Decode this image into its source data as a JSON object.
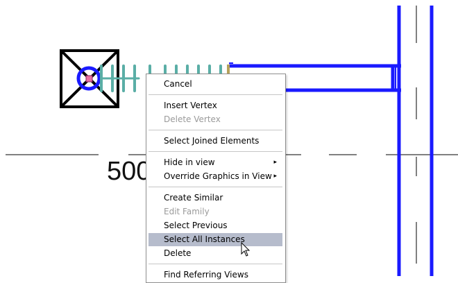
{
  "drawing": {
    "dimension_text": "500"
  },
  "context_menu": {
    "items": [
      {
        "label": "Cancel",
        "enabled": true
      },
      {
        "label": "Insert Vertex",
        "enabled": true
      },
      {
        "label": "Delete Vertex",
        "enabled": false
      },
      {
        "label": "Select Joined Elements",
        "enabled": true
      },
      {
        "label": "Hide in view",
        "enabled": true,
        "submenu": true
      },
      {
        "label": "Override Graphics in View",
        "enabled": true,
        "submenu": true
      },
      {
        "label": "Create Similar",
        "enabled": true
      },
      {
        "label": "Edit Family",
        "enabled": false
      },
      {
        "label": "Select Previous",
        "enabled": true
      },
      {
        "label": "Select All Instances",
        "enabled": true,
        "highlighted": true
      },
      {
        "label": "Delete",
        "enabled": true
      },
      {
        "label": "Find Referring Views",
        "enabled": true
      }
    ],
    "submenu_arrow": "▸"
  },
  "colors": {
    "structure_blue": "#1a1aff",
    "insulation_teal": "#5aaea6",
    "menu_highlight": "#b6bccc",
    "disabled_text": "#9a9a9a"
  },
  "cursor_icon": "arrow-pointer-icon"
}
